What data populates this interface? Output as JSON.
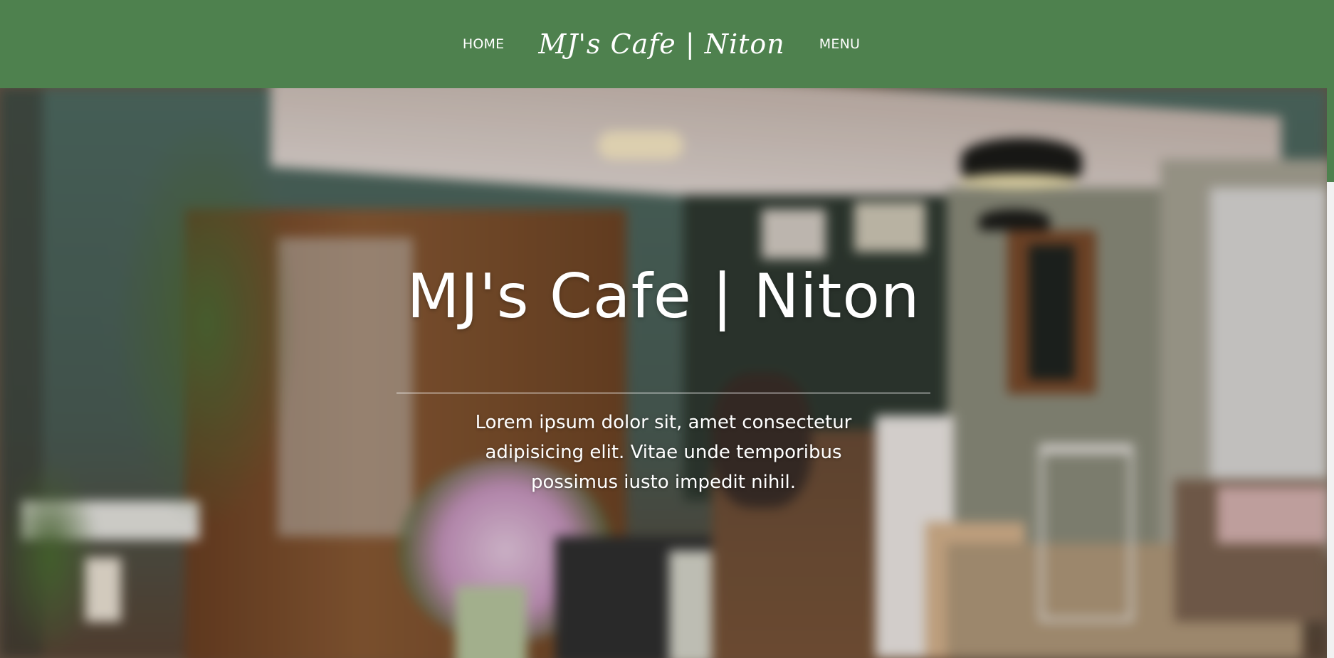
{
  "nav": {
    "home": "HOME",
    "brand": "MJ's Cafe | Niton",
    "menu": "MENU"
  },
  "hero": {
    "title": "MJ's Cafe | Niton",
    "text": "Lorem ipsum dolor sit, amet consectetur adipisicing elit. Vitae unde temporibus possimus iusto impedit nihil."
  },
  "colors": {
    "nav_green": "#4e814e",
    "text": "#ffffff"
  }
}
